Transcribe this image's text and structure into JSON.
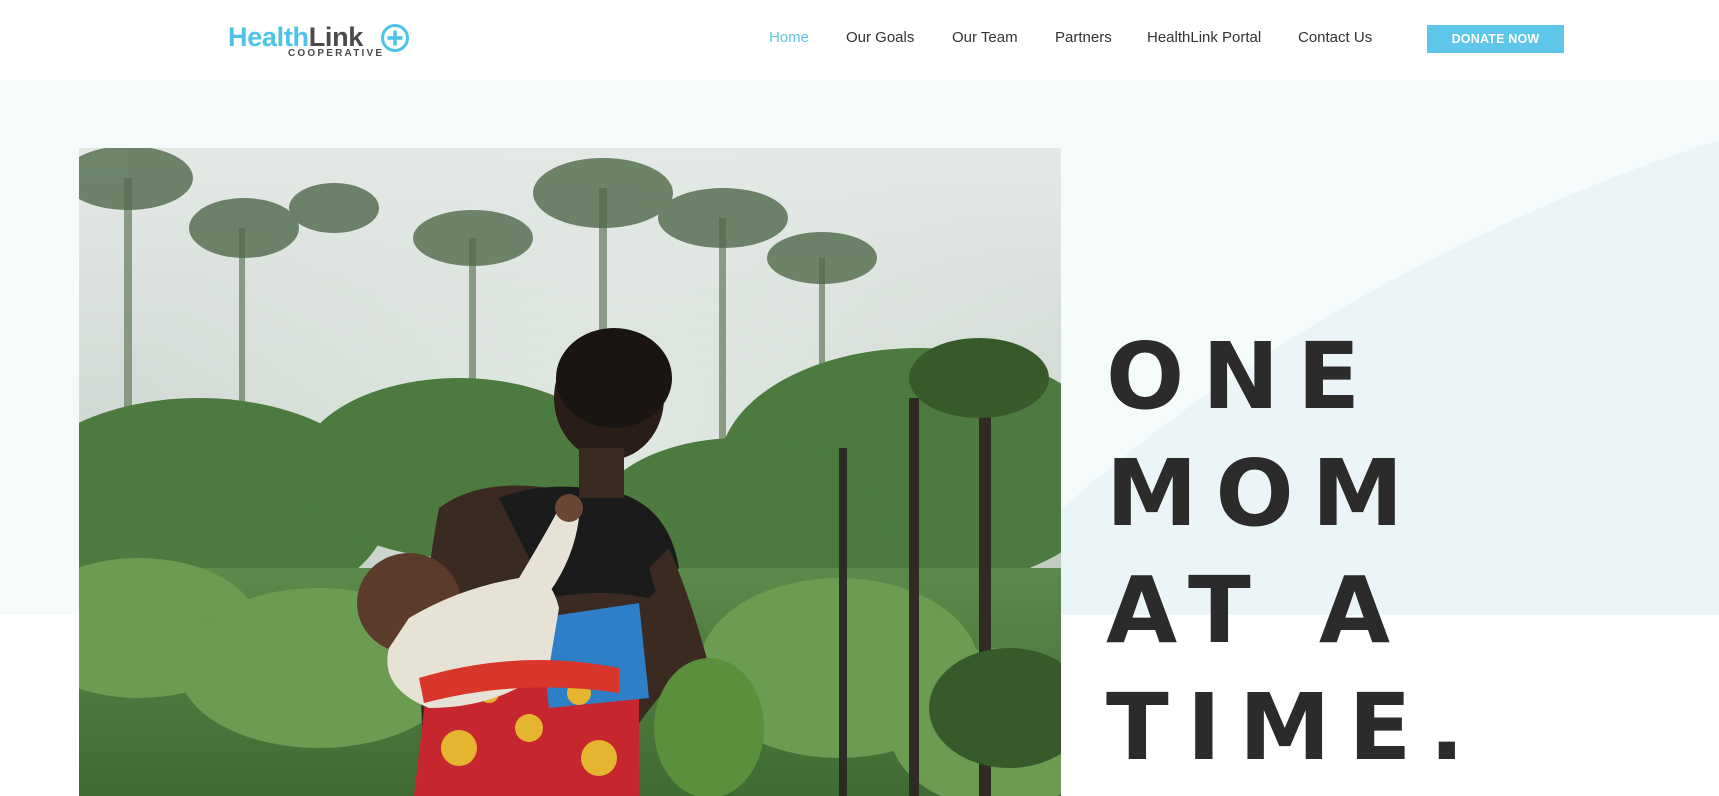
{
  "logo": {
    "word_part1": "Health",
    "word_part2": "Link",
    "subtitle": "COOPERATIVE",
    "icon": "plus-circle-icon",
    "colors": {
      "primary": "#4fc3e6",
      "dark": "#4a4a4a"
    }
  },
  "nav": {
    "items": [
      {
        "label": "Home",
        "active": true
      },
      {
        "label": "Our Goals",
        "active": false
      },
      {
        "label": "Our Team",
        "active": false
      },
      {
        "label": "Partners",
        "active": false
      },
      {
        "label": "HealthLink Portal",
        "active": false
      },
      {
        "label": "Contact Us",
        "active": false
      }
    ],
    "active_color": "#5ec6e8"
  },
  "donate_button": {
    "label": "DONATE NOW",
    "color": "#5ec6e8"
  },
  "hero": {
    "headline_lines": [
      "ONE",
      "MOM",
      "AT A",
      "TIME."
    ],
    "background_color": "#f5fafb",
    "curve_color": "#ebf4f6"
  }
}
